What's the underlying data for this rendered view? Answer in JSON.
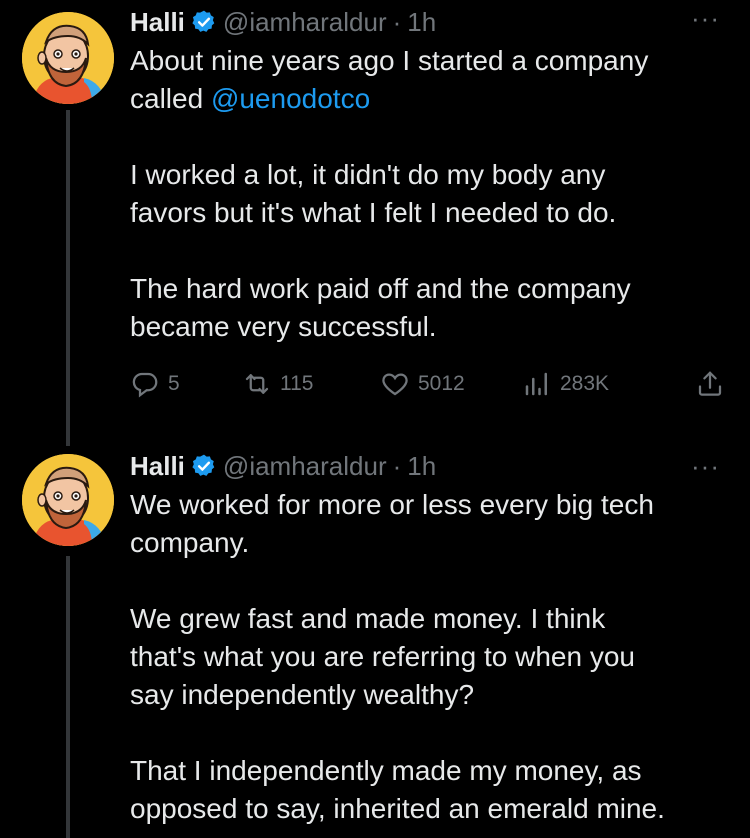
{
  "tweets": [
    {
      "name": "Halli",
      "handle": "@iamharaldur",
      "separator": "·",
      "time": "1h",
      "more": "···",
      "text_p1_a": "About nine years ago I started a company",
      "text_p1_b": "called ",
      "mention": "@uenodotco",
      "text_p2_a": "I worked a lot, it didn't do my body any",
      "text_p2_b": "favors but it's what I felt I needed to do.",
      "text_p3_a": "The hard work paid off and the company",
      "text_p3_b": "became very successful.",
      "replies": "5",
      "retweets": "115",
      "likes": "5012",
      "views": "283K"
    },
    {
      "name": "Halli",
      "handle": "@iamharaldur",
      "separator": "·",
      "time": "1h",
      "more": "···",
      "text_p1_a": "We worked for more or less every big tech",
      "text_p1_b": "company.",
      "text_p2_a": "We grew fast and made money. I think",
      "text_p2_b": "that's what you are referring to when you",
      "text_p2_c": "say independently wealthy?",
      "text_p3_a": "That I independently made my money, as",
      "text_p3_b": "opposed to say, inherited an emerald mine."
    }
  ],
  "colors": {
    "background": "#000000",
    "text": "#e7e9ea",
    "muted": "#71767b",
    "accent": "#1d9bf0"
  }
}
